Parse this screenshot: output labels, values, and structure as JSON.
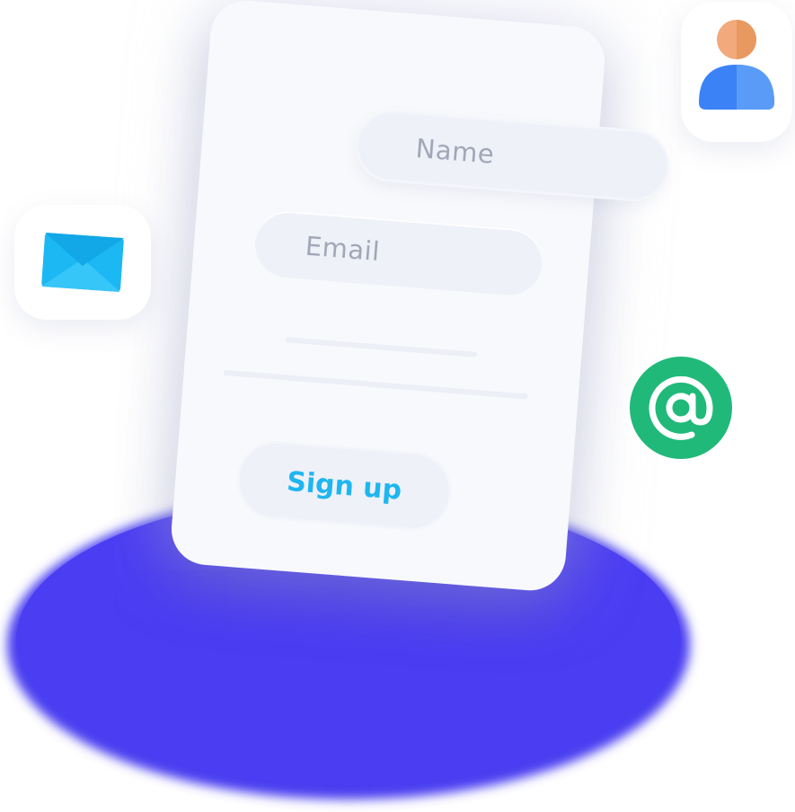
{
  "form": {
    "name_placeholder": "Name",
    "email_placeholder": "Email",
    "submit_label": "Sign up"
  },
  "icons": {
    "user": "user-avatar-icon",
    "mail": "envelope-icon",
    "at": "at-sign-icon"
  },
  "colors": {
    "platform": "#4a3cf0",
    "card": "#f8f9fc",
    "field": "#eef1f8",
    "placeholder_text": "#a2a7b7",
    "button_text": "#1fb6f0",
    "at_badge": "#20b97a",
    "envelope": "#1bb8f3",
    "avatar_head": "#f2a97b",
    "avatar_body": "#3b82f6"
  }
}
